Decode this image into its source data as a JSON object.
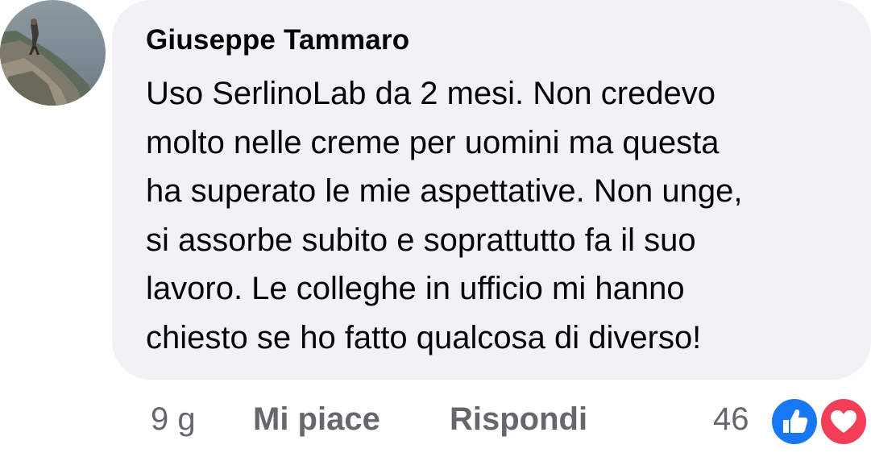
{
  "comment": {
    "author": "Giuseppe Tammaro",
    "lines": [
      "Uso SerlinoLab da 2 mesi. Non credevo",
      "molto nelle creme per uomini ma questa",
      "ha superato le mie aspettative. Non unge,",
      "si assorbe subito e soprattutto fa il suo",
      "lavoro. Le colleghe in ufficio mi hanno",
      "chiesto se ho fatto qualcosa di diverso!"
    ]
  },
  "actions": {
    "timestamp": "9 g",
    "like_label": "Mi piace",
    "reply_label": "Rispondi"
  },
  "reactions": {
    "count": "46",
    "icons": [
      "like-icon",
      "love-icon"
    ],
    "colors": {
      "like": "#1877f2",
      "love": "#f33e58"
    }
  },
  "colors": {
    "bubble": "#f0f2f5",
    "text": "#050505",
    "secondary_text": "#65676b"
  }
}
